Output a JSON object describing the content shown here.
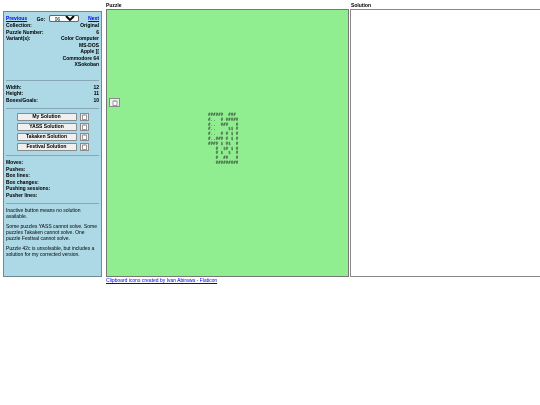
{
  "nav": {
    "previous": "Previous",
    "go_label": "Go:",
    "go_value": "06",
    "next": "Next"
  },
  "info": {
    "collection_label": "Collection:",
    "collection_value": "Original",
    "puzzle_number_label": "Puzzle Number:",
    "puzzle_number_value": "6",
    "variants_label": "Variant(s):",
    "variants": [
      "Color Computer",
      "MS-DOS",
      "Apple ][",
      "Commodore 64",
      "XSokoban"
    ]
  },
  "dims": {
    "width_label": "Width:",
    "width_value": "12",
    "height_label": "Height:",
    "height_value": "11",
    "boxes_label": "Boxes/Goals:",
    "boxes_value": "10"
  },
  "solutions": {
    "my": "My Solution",
    "yass": "YASS Solution",
    "takaken": "Takaken Solution",
    "festival": "Festival Solution"
  },
  "stats": {
    "moves": "Moves:",
    "pushes": "Pushes:",
    "box_lines": "Box lines:",
    "box_changes": "Box changes:",
    "pushing_sessions": "Pushing sessions:",
    "pusher_lines": "Pusher lines:"
  },
  "notes": {
    "n1": "Inactive button means no solution available.",
    "n2": "Some puzzles YASS cannot solve. Some puzzles Takaken cannot solve. One puzzle Festival cannot solve.",
    "n3": "Puzzle 42c is unsolvable, but includes a solution for my corrected version."
  },
  "headers": {
    "puzzle": "Puzzle",
    "solution": "Solution"
  },
  "puzzle_grid": [
    "######  ###",
    "#..  # #####",
    "#..  ###   #",
    "#..     $$ #",
    "#..  # # $ #",
    "#..### # $ #",
    "#### $ #$  #",
    "   #  $# $ #",
    "   # $  $  #",
    "   #  ##   #",
    "   #########"
  ],
  "credit": "Clipboard icons created by Ivan Abirawa - Flaticon",
  "colors": {
    "sidebar_bg": "#add8e6",
    "puzzle_bg": "#90ee90",
    "link": "#0000ee"
  }
}
